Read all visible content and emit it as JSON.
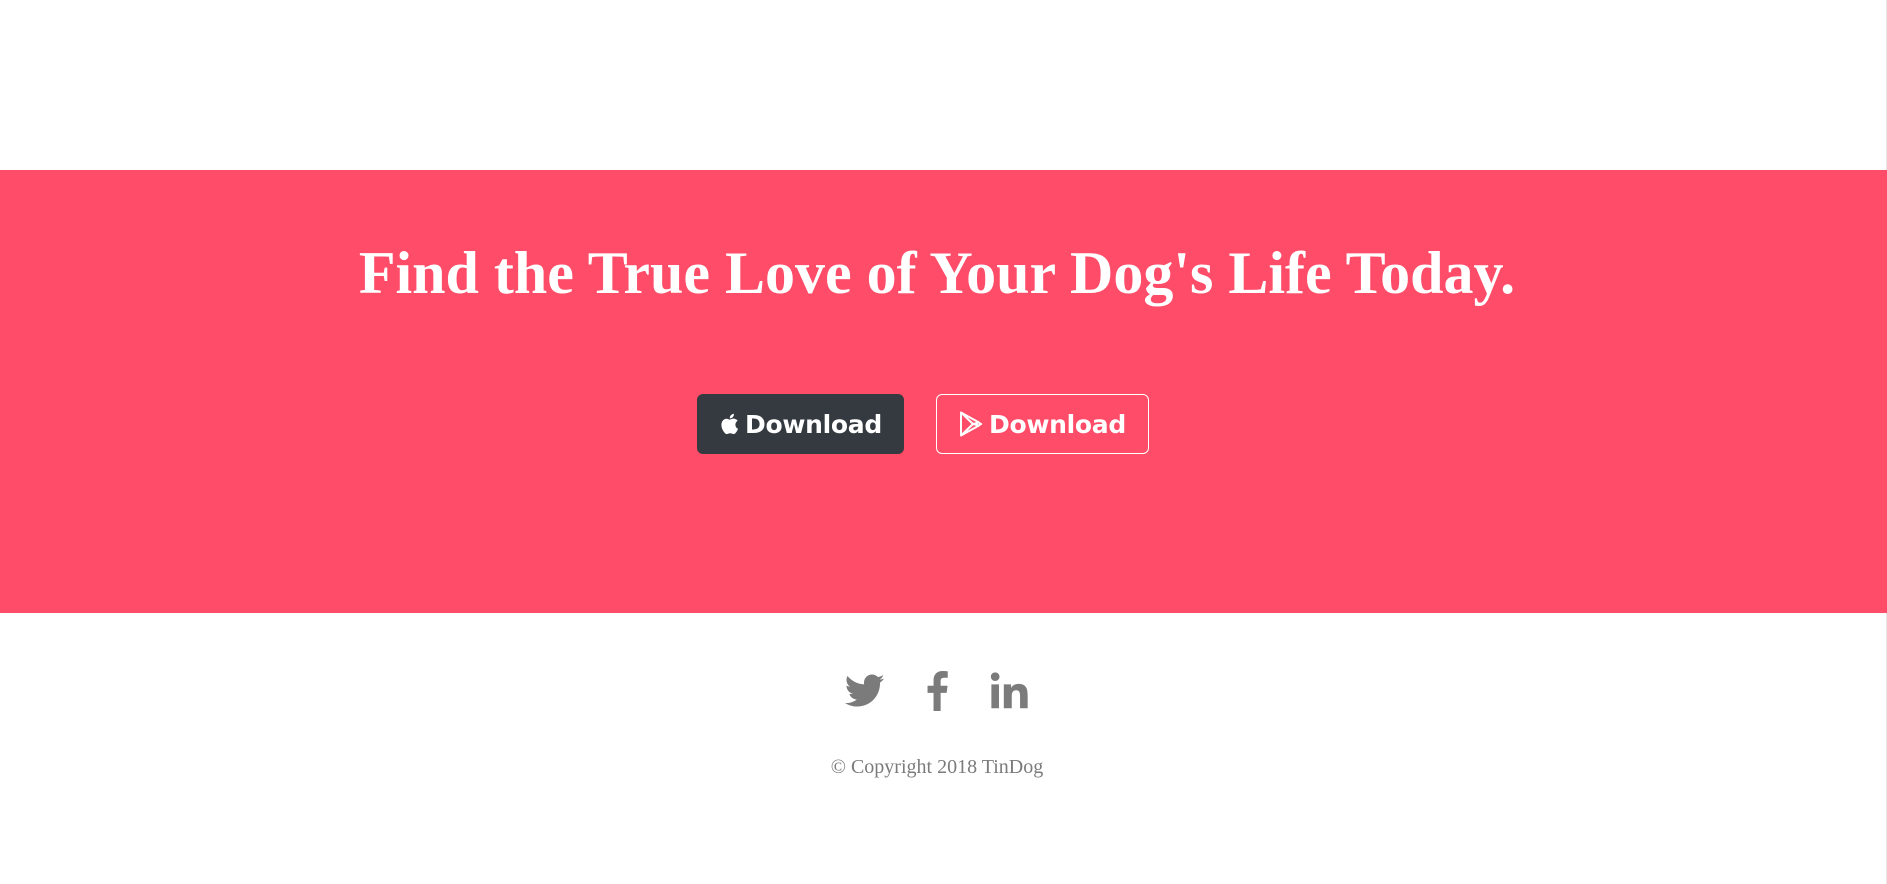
{
  "cta": {
    "heading": "Find the True Love of Your Dog's Life Today.",
    "background_color": "#ff4c68",
    "buttons": [
      {
        "label": "Download",
        "icon": "apple-icon",
        "style": "dark"
      },
      {
        "label": "Download",
        "icon": "google-play-icon",
        "style": "outline-light"
      }
    ]
  },
  "footer": {
    "social_icons": [
      "twitter-icon",
      "facebook-icon",
      "linkedin-icon"
    ],
    "copyright": "© Copyright 2018 TinDog",
    "icon_color": "#7b7b7b"
  }
}
